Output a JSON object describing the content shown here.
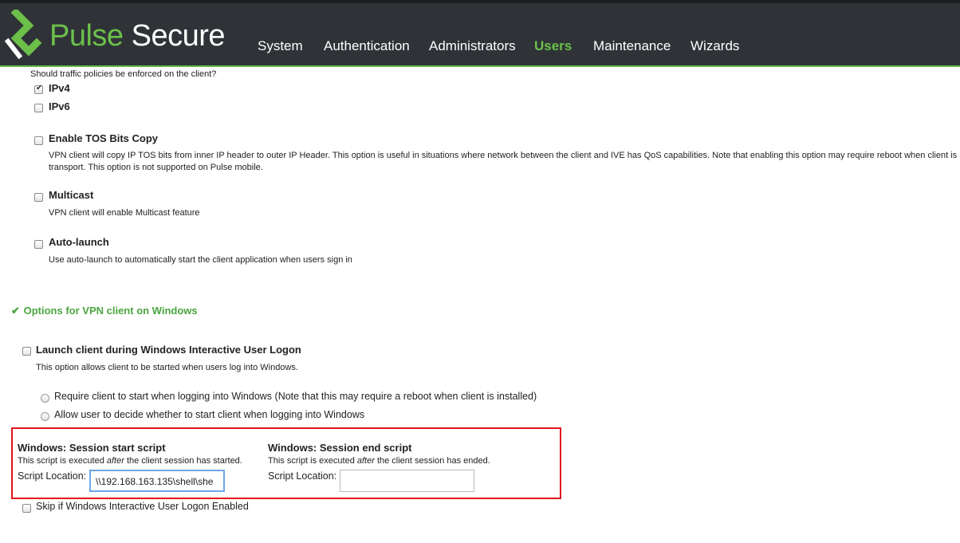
{
  "header": {
    "brand_pulse": "Pulse",
    "brand_secure": "Secure",
    "nav": [
      "System",
      "Authentication",
      "Administrators",
      "Users",
      "Maintenance",
      "Wizards"
    ],
    "active_nav": "Users",
    "accent_color": "#6cc04a"
  },
  "traffic_policy": {
    "question": "Should traffic policies be enforced on the client?",
    "ipv4_label": "IPv4",
    "ipv4_checked": true,
    "ipv6_label": "IPv6",
    "ipv6_checked": false
  },
  "tos": {
    "label": "Enable TOS Bits Copy",
    "desc_line1": "VPN client will copy IP TOS bits from inner IP header to outer IP Header. This option is useful in situations where network between the client and IVE has QoS capabilities. Note that enabling this option may require reboot when client is",
    "desc_line2": "transport. This option is not supported on Pulse mobile."
  },
  "multicast": {
    "label": "Multicast",
    "desc": "VPN client will enable Multicast feature"
  },
  "autolaunch": {
    "label": "Auto-launch",
    "desc": "Use auto-launch to automatically start the client application when users sign in"
  },
  "windows_section": {
    "title": "Options for VPN client on Windows",
    "launch_label": "Launch client during Windows Interactive User Logon",
    "launch_desc": "This option allows client to be started when users log into Windows.",
    "radio1": "Require client to start when logging into Windows (Note that this may require a reboot when client is installed)",
    "radio2": "Allow user to decide whether to start client when logging into Windows"
  },
  "scripts": {
    "start_title": "Windows: Session start script",
    "start_desc_pre": "This script is executed ",
    "start_desc_em": "after",
    "start_desc_post": " the client session has started.",
    "start_location_label": "Script Location:",
    "start_location_value": "\\\\192.168.163.135\\shell\\she",
    "end_title": "Windows: Session end script",
    "end_desc_pre": "This script is executed ",
    "end_desc_em": "after",
    "end_desc_post": " the client session has ended.",
    "end_location_label": "Script Location:",
    "end_location_value": ""
  },
  "skip": {
    "label": "Skip if Windows Interactive User Logon Enabled"
  }
}
